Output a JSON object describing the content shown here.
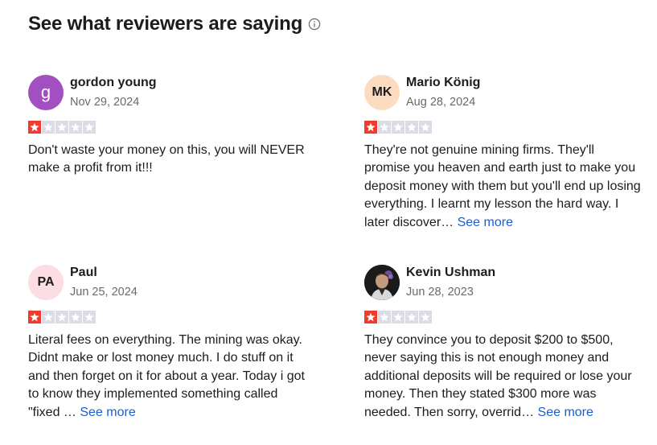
{
  "section": {
    "title": "See what reviewers are saying"
  },
  "colors": {
    "star_filled": "#ef3b2e",
    "star_empty": "#dcdce6",
    "link": "#1a5fd1"
  },
  "reviews": [
    {
      "name": "gordon young",
      "date": "Nov 29, 2024",
      "avatar_text": "g",
      "avatar_bg": "#a24fc2",
      "avatar_fg": "#ffffff",
      "rating": 1,
      "max_rating": 5,
      "text": "Don't waste your money on this, you will NEVER make a profit from it!!!",
      "see_more": ""
    },
    {
      "name": "Mario König",
      "date": "Aug 28, 2024",
      "avatar_text": "MK",
      "avatar_bg": "#fcdcc0",
      "avatar_fg": "#1c1c1c",
      "rating": 1,
      "max_rating": 5,
      "text": "They're not genuine mining firms. They'll promise you heaven and earth just to make you deposit money with them but you'll end up losing everything. I learnt my lesson the hard way. I later discover…",
      "see_more": "See more"
    },
    {
      "name": "Paul",
      "date": "Jun 25, 2024",
      "avatar_text": "PA",
      "avatar_bg": "#fbdde3",
      "avatar_fg": "#1c1c1c",
      "rating": 1,
      "max_rating": 5,
      "text": "Literal fees on everything. The mining was okay. Didnt make or lost money much. I do stuff on it and then forget on it for about a year. Today i got to know they implemented something called \"fixed …",
      "see_more": "See more"
    },
    {
      "name": "Kevin Ushman",
      "date": "Jun 28, 2023",
      "avatar_text": "",
      "avatar_bg": "#222222",
      "avatar_fg": "#ffffff",
      "rating": 1,
      "max_rating": 5,
      "text": "They convince you to deposit $200 to $500, never saying this is not enough money and additional deposits will be required or lose your money. Then they stated $300 more was needed. Then sorry, overrid…",
      "see_more": "See more"
    }
  ]
}
